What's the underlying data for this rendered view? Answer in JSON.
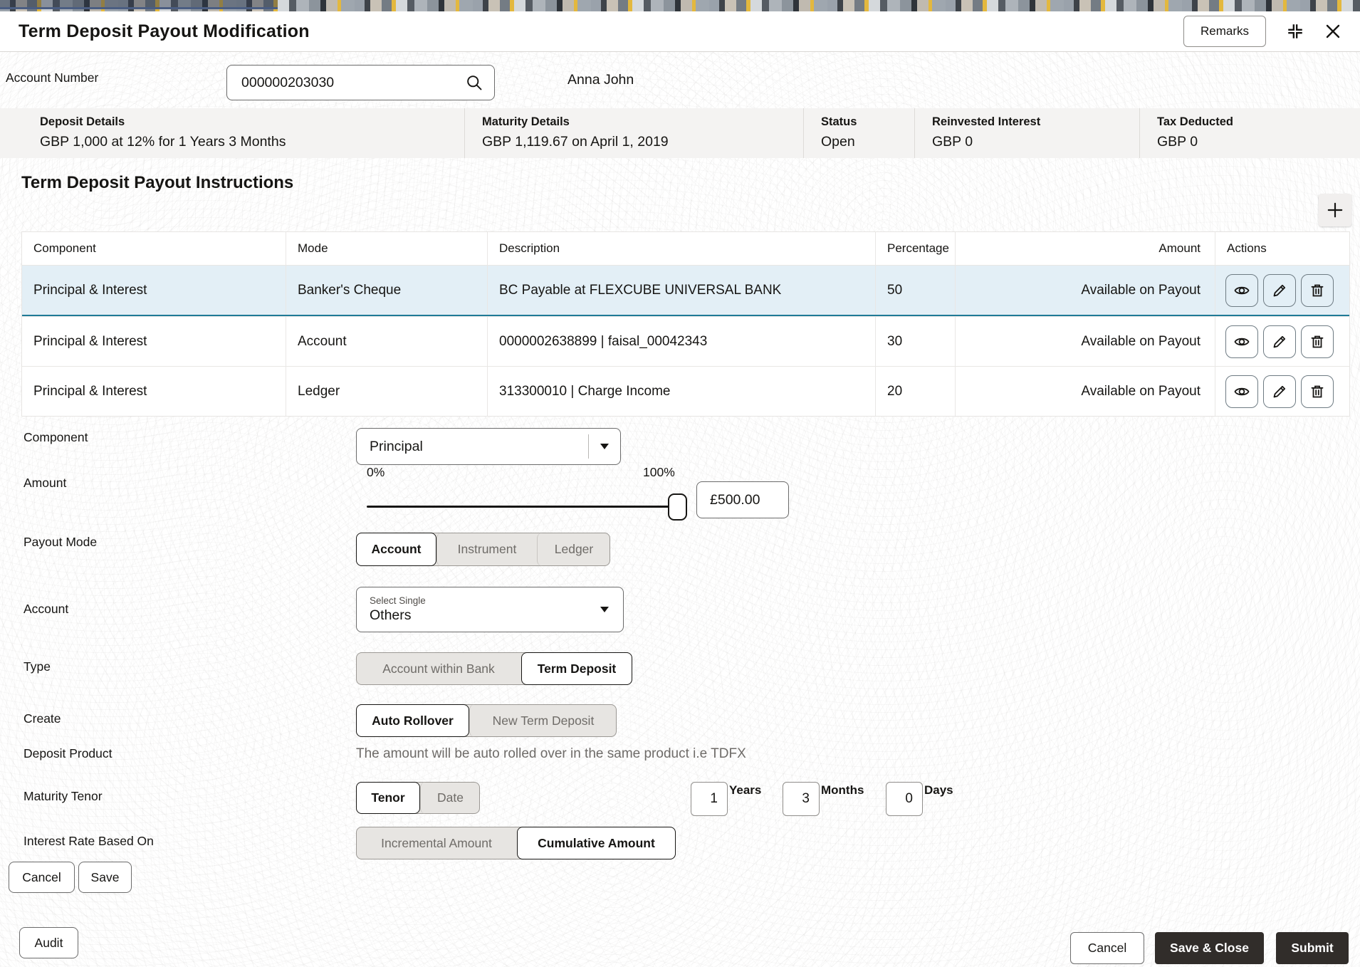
{
  "header": {
    "title": "Term Deposit Payout Modification",
    "remarks_label": "Remarks"
  },
  "account": {
    "label": "Account Number",
    "value": "000000203030",
    "holder_name": "Anna John"
  },
  "summary": {
    "deposit": {
      "label": "Deposit Details",
      "value": "GBP 1,000 at 12% for 1 Years 3 Months"
    },
    "maturity": {
      "label": "Maturity Details",
      "value": "GBP 1,119.67 on April 1, 2019"
    },
    "status": {
      "label": "Status",
      "value": "Open"
    },
    "reinvested": {
      "label": "Reinvested Interest",
      "value": "GBP 0"
    },
    "tax": {
      "label": "Tax Deducted",
      "value": "GBP 0"
    }
  },
  "instructions": {
    "title": "Term Deposit Payout Instructions",
    "columns": {
      "component": "Component",
      "mode": "Mode",
      "description": "Description",
      "percentage": "Percentage",
      "amount": "Amount",
      "actions": "Actions"
    },
    "rows": [
      {
        "component": "Principal & Interest",
        "mode": "Banker's Cheque",
        "description": "BC Payable at FLEXCUBE UNIVERSAL BANK",
        "percentage": "50",
        "amount": "Available on Payout"
      },
      {
        "component": "Principal & Interest",
        "mode": "Account",
        "description": "0000002638899 | faisal_00042343",
        "percentage": "30",
        "amount": "Available on Payout"
      },
      {
        "component": "Principal & Interest",
        "mode": "Ledger",
        "description": "313300010 | Charge Income",
        "percentage": "20",
        "amount": "Available on Payout"
      }
    ]
  },
  "form": {
    "component": {
      "label": "Component",
      "value": "Principal"
    },
    "amount": {
      "label": "Amount",
      "min_label": "0%",
      "max_label": "100%",
      "value": "£500.00"
    },
    "payout_mode": {
      "label": "Payout Mode",
      "options": [
        "Account",
        "Instrument",
        "Ledger"
      ],
      "selected": "Account"
    },
    "account_select": {
      "label": "Account",
      "float_label": "Select Single",
      "value": "Others"
    },
    "type": {
      "label": "Type",
      "options": [
        "Account within Bank",
        "Term Deposit"
      ],
      "selected": "Term Deposit"
    },
    "create": {
      "label": "Create",
      "options": [
        "Auto Rollover",
        "New Term Deposit"
      ],
      "selected": "Auto Rollover"
    },
    "deposit_product": {
      "label": "Deposit Product",
      "helper": "The amount will be auto rolled over in the same product i.e TDFX"
    },
    "maturity_tenor": {
      "label": "Maturity Tenor",
      "options": [
        "Tenor",
        "Date"
      ],
      "selected": "Tenor",
      "years": {
        "value": "1",
        "unit": "Years"
      },
      "months": {
        "value": "3",
        "unit": "Months"
      },
      "days": {
        "value": "0",
        "unit": "Days"
      }
    },
    "interest_rate": {
      "label": "Interest Rate Based On",
      "options": [
        "Incremental Amount",
        "Cumulative Amount"
      ],
      "selected": "Cumulative Amount"
    },
    "cancel_label": "Cancel",
    "save_label": "Save"
  },
  "footer": {
    "audit_label": "Audit",
    "cancel_label": "Cancel",
    "save_close_label": "Save & Close",
    "submit_label": "Submit"
  },
  "colors": {
    "accent_teal": "#1f7a96",
    "selected_row_bg": "#e3eff6",
    "dark_button_bg": "#312d2a",
    "summary_bar_bg": "#f4f3f2"
  }
}
